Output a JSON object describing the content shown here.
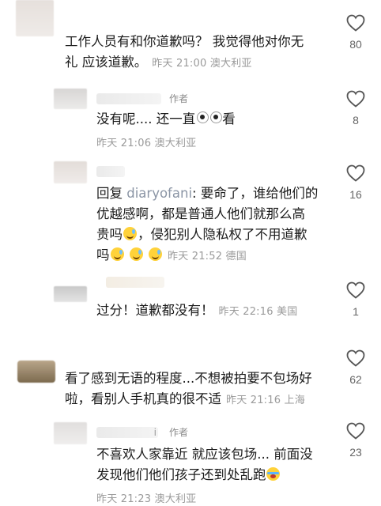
{
  "comments": [
    {
      "text_lines": [
        "工作人员有和你道歉吗？ 我觉得他对你无",
        "礼 应该道歉。"
      ],
      "time": "昨天 21:00",
      "location": "澳大利亚",
      "likes": "80"
    },
    {
      "author_tag": "作者",
      "text_lines": [
        "没有呢.... 还一直",
        "看"
      ],
      "time": "昨天 21:06",
      "location": "澳大利亚",
      "likes": "8"
    },
    {
      "reply_prefix": "回复",
      "reply_to": "diaryofani",
      "text_lines": [
        ": 要命了，谁给他们的",
        "优越感啊，都是普通人他们就那么高",
        "贵吗",
        "，侵犯别人隐私权了不用道歉",
        "吗"
      ],
      "time": "昨天 21:52",
      "location": "德国",
      "likes": "16"
    },
    {
      "text_lines": [
        "过分！道歉都没有！"
      ],
      "time": "昨天 22:16",
      "location": "美国",
      "likes": "1"
    },
    {
      "text_lines": [
        "看了感到无语的程度...不想被拍要不包场好",
        "啦，看别人手机真的很不适"
      ],
      "time": "昨天 21:16",
      "location": "上海",
      "likes": "62"
    },
    {
      "author_tag": "作者",
      "name_fragment": "i",
      "text_lines": [
        "不喜欢人家靠近 就应该包场... 前面没",
        "发现他们他们孩子还到处乱跑"
      ],
      "time": "昨天 21:23",
      "location": "澳大利亚",
      "likes": "23"
    }
  ],
  "icons": {
    "like": "heart-outline-icon",
    "emoji_sweat": "grinning-sweat-emoji",
    "emoji_eyes": "eyes-emoji",
    "emoji_cry": "crying-emoji"
  },
  "colors": {
    "text": "#1b1b1b",
    "meta": "#9a9a9a",
    "reply_name": "#8b95a5",
    "heart": "#555555"
  }
}
